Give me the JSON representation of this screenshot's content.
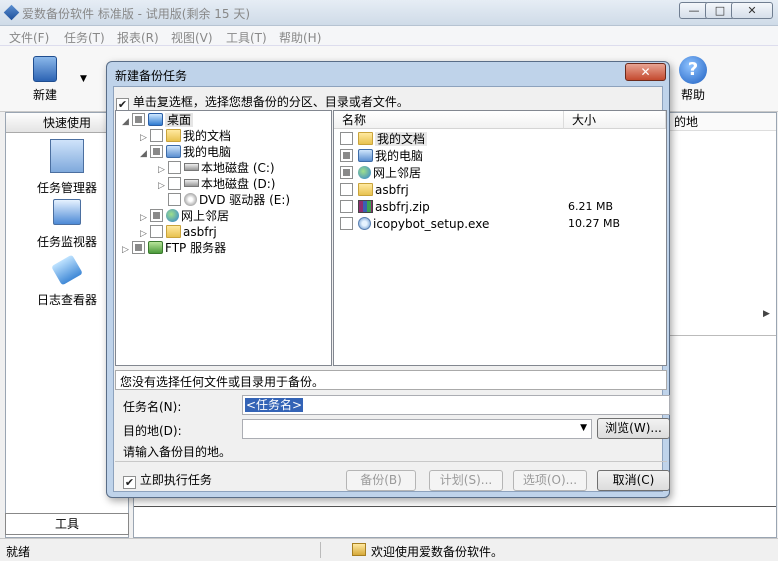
{
  "window": {
    "title": "爱数备份软件 标准版 - 试用版(剩余 15 天)",
    "controls": [
      "—",
      "□",
      "✕"
    ]
  },
  "menu": [
    "文件(F)",
    "任务(T)",
    "报表(R)",
    "视图(V)",
    "工具(T)",
    "帮助(H)"
  ],
  "toolbar": {
    "new_label": "新建",
    "help_label": "帮助"
  },
  "left_panel": {
    "header": "快速使用",
    "items": [
      "任务管理器",
      "任务监视器",
      "日志查看器"
    ],
    "tools_tab": "工具"
  },
  "right_area": {
    "dest_header_fragment": "的地"
  },
  "status": {
    "left": "就绪",
    "message": "欢迎使用爱数备份软件。"
  },
  "dialog": {
    "title": "新建备份任务",
    "close_glyph": "✕",
    "instruction": "单击复选框，选择您想备份的分区、目录或者文件。",
    "tree": [
      {
        "label": "桌面",
        "icon": "desktop-icon",
        "state": "mid",
        "level": 0,
        "expand": "◢"
      },
      {
        "label": "我的文档",
        "icon": "folder-icon",
        "state": "off",
        "level": 1,
        "expand": "▷"
      },
      {
        "label": "我的电脑",
        "icon": "computer-icon",
        "state": "mid",
        "level": 1,
        "expand": "◢"
      },
      {
        "label": "本地磁盘 (C:)",
        "icon": "disk-icon",
        "state": "off",
        "level": 2,
        "expand": "▷"
      },
      {
        "label": "本地磁盘 (D:)",
        "icon": "disk-icon",
        "state": "off",
        "level": 2,
        "expand": "▷"
      },
      {
        "label": "DVD 驱动器 (E:)",
        "icon": "dvd-icon",
        "state": "off",
        "level": 2,
        "expand": ""
      },
      {
        "label": "网上邻居",
        "icon": "network-icon",
        "state": "mid",
        "level": 1,
        "expand": "▷"
      },
      {
        "label": "asbfrj",
        "icon": "folder-icon",
        "state": "off",
        "level": 1,
        "expand": "▷"
      },
      {
        "label": "FTP 服务器",
        "icon": "ftp-icon",
        "state": "mid",
        "level": 0,
        "expand": "▷"
      }
    ],
    "list_columns": [
      "名称",
      "大小"
    ],
    "files": [
      {
        "name": "我的文档",
        "icon": "folder-icon",
        "size": "",
        "state": "off"
      },
      {
        "name": "我的电脑",
        "icon": "computer-icon",
        "size": "",
        "state": "mid"
      },
      {
        "name": "网上邻居",
        "icon": "network-icon",
        "size": "",
        "state": "mid"
      },
      {
        "name": "asbfrj",
        "icon": "folder-icon",
        "size": "",
        "state": "off"
      },
      {
        "name": "asbfrj.zip",
        "icon": "zip-icon",
        "size": "6.21 MB",
        "state": "off"
      },
      {
        "name": "icopybot_setup.exe",
        "icon": "exe-icon",
        "size": "10.27 MB",
        "state": "off"
      }
    ],
    "selection_info": "您没有选择任何文件或目录用于备份。",
    "task_name_label": "任务名(N):",
    "task_name_value": "<任务名>",
    "destination_label": "目的地(D):",
    "destination_value": "",
    "browse_button": "浏览(W)...",
    "destination_hint": "请输入备份目的地。",
    "run_now_label": "立即执行任务",
    "run_now_checked": true,
    "buttons": {
      "backup": "备份(B)",
      "schedule": "计划(S)...",
      "options": "选项(O)...",
      "cancel": "取消(C)"
    }
  }
}
